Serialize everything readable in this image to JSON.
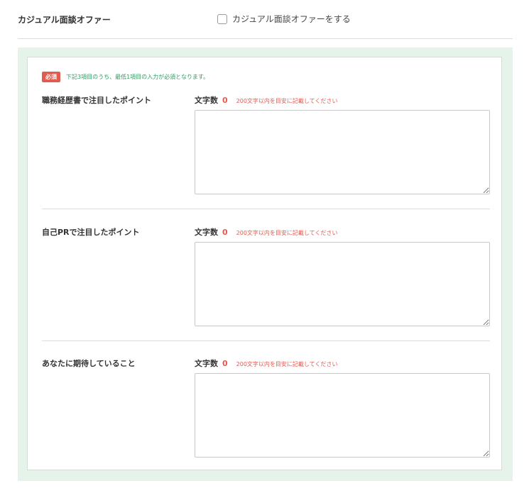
{
  "offer": {
    "label": "カジュアル面談オファー",
    "checkbox_label": "カジュアル面談オファーをする",
    "checked": false
  },
  "required": {
    "badge": "必須",
    "note": "下記3項目のうち、最低1項目の入力が必須となります。"
  },
  "fields": [
    {
      "label": "職務経歴書で注目したポイント",
      "counter_label": "文字数",
      "count": "0",
      "hint": "200文字以内を目安に記載してください",
      "value": ""
    },
    {
      "label": "自己PRで注目したポイント",
      "counter_label": "文字数",
      "count": "0",
      "hint": "200文字以内を目安に記載してください",
      "value": ""
    },
    {
      "label": "あなたに期待していること",
      "counter_label": "文字数",
      "count": "0",
      "hint": "200文字以内を目安に記載してください",
      "value": ""
    }
  ],
  "colors": {
    "accent_red": "#e35a4f",
    "accent_green": "#2a9d5f",
    "panel_bg": "#e6f3eb"
  }
}
